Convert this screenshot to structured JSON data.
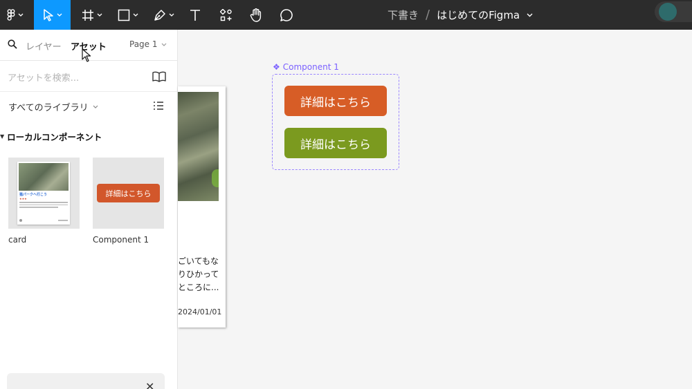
{
  "toolbar": {
    "tools": [
      {
        "name": "figma-menu",
        "icon": "figma-logo-icon"
      },
      {
        "name": "move",
        "icon": "cursor-arrow-icon",
        "active": true
      },
      {
        "name": "frame",
        "icon": "frame-hash-icon"
      },
      {
        "name": "shape",
        "icon": "rectangle-icon"
      },
      {
        "name": "pen",
        "icon": "pen-icon"
      },
      {
        "name": "text",
        "icon": "text-t-icon"
      },
      {
        "name": "resources",
        "icon": "resources-icon"
      },
      {
        "name": "hand",
        "icon": "hand-icon"
      },
      {
        "name": "comment",
        "icon": "comment-bubble-icon"
      }
    ],
    "breadcrumb": {
      "draft": "下書き",
      "separator": "/",
      "file": "はじめてのFigma"
    },
    "colors": {
      "bg": "#2c2c2c",
      "active": "#0d99ff",
      "avatar": "#2e6b6b"
    }
  },
  "panel": {
    "tabs": {
      "layers": "レイヤー",
      "assets": "アセット",
      "page": "Page 1"
    },
    "search_placeholder": "アセットを検索...",
    "library": "すべてのライブラリ",
    "section": "ローカルコンポーネント",
    "assets": [
      {
        "label": "card",
        "mini_title": "猫パークへ行こう",
        "mini_stars": "★★★"
      },
      {
        "label": "Component 1",
        "button_text": "詳細はこちら"
      }
    ]
  },
  "canvas": {
    "card": {
      "text_lines": [
        "ごいてもな",
        "りひかって",
        "ところに..."
      ],
      "date": "2024/01/01"
    },
    "component": {
      "label": "Component 1",
      "buttons": [
        {
          "text": "詳細はこちら",
          "color": "#d75d26"
        },
        {
          "text": "詳細はこちら",
          "color": "#7b9a1f"
        }
      ],
      "accent": "#7b61ff"
    }
  }
}
